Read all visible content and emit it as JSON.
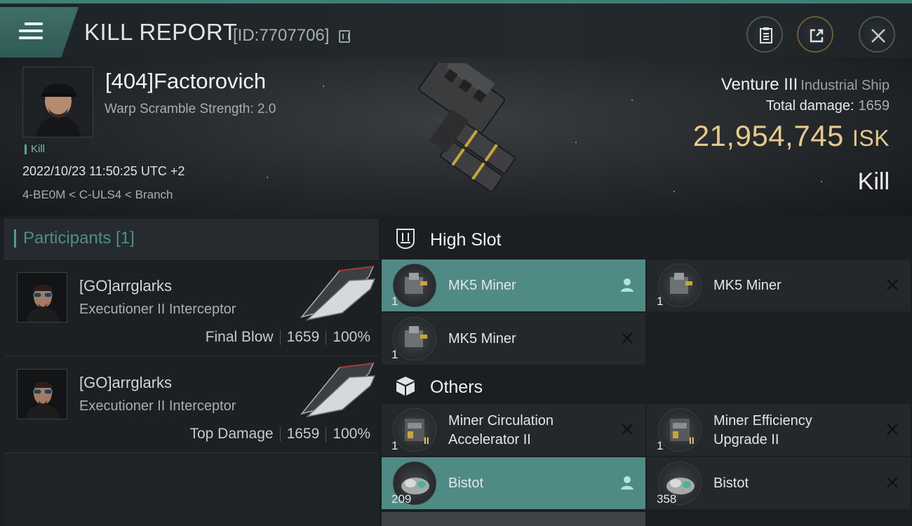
{
  "header": {
    "title": "KILL REPORT",
    "report_id": "[ID:7707706]",
    "icons": [
      "menu-icon",
      "copy-icon",
      "clipboard-icon",
      "share-icon",
      "close-icon"
    ]
  },
  "victim": {
    "name": "[404]Factorovich",
    "warp_scramble": "Warp Scramble Strength: 2.0",
    "tag": "Kill",
    "datetime": "2022/10/23 11:50:25 UTC +2",
    "location": "4-BE0M < C-ULS4 < Branch"
  },
  "ship": {
    "name": "Venture III",
    "class": "Industrial Ship",
    "total_damage_label": "Total damage:",
    "total_damage": "1659",
    "isk_value": "21,954,745",
    "isk_unit": "ISK",
    "result": "Kill"
  },
  "participants": {
    "label": "Participants [1]",
    "rows": [
      {
        "name": "[GO]arrglarks",
        "ship": "Executioner II Interceptor",
        "role": "Final Blow",
        "damage": "1659",
        "percent": "100%"
      },
      {
        "name": "[GO]arrglarks",
        "ship": "Executioner II Interceptor",
        "role": "Top Damage",
        "damage": "1659",
        "percent": "100%"
      }
    ]
  },
  "fittings": {
    "high_slot_label": "High Slot",
    "others_label": "Others",
    "high_slot": [
      {
        "name": "MK5 Miner",
        "qty": "1",
        "action": "person-icon",
        "active": true
      },
      {
        "name": "MK5 Miner",
        "qty": "1",
        "action": "close-icon",
        "active": false
      },
      {
        "name": "MK5 Miner",
        "qty": "1",
        "action": "close-icon",
        "active": false
      }
    ],
    "others": [
      {
        "name_line1": "Miner Circulation",
        "name_line2": "Accelerator II",
        "qty": "1",
        "tier": "II",
        "action": "close-icon"
      },
      {
        "name_line1": "Miner Efficiency",
        "name_line2": "Upgrade II",
        "qty": "1",
        "tier": "II",
        "action": "close-icon"
      },
      {
        "name": "Bistot",
        "qty": "209",
        "action": "person-icon",
        "active": true
      },
      {
        "name": "Bistot",
        "qty": "358",
        "action": "close-icon",
        "active": false
      }
    ]
  },
  "colors": {
    "accent": "#4f8b84",
    "isk": "#e9c98a",
    "participants_label": "#4e8e86"
  }
}
